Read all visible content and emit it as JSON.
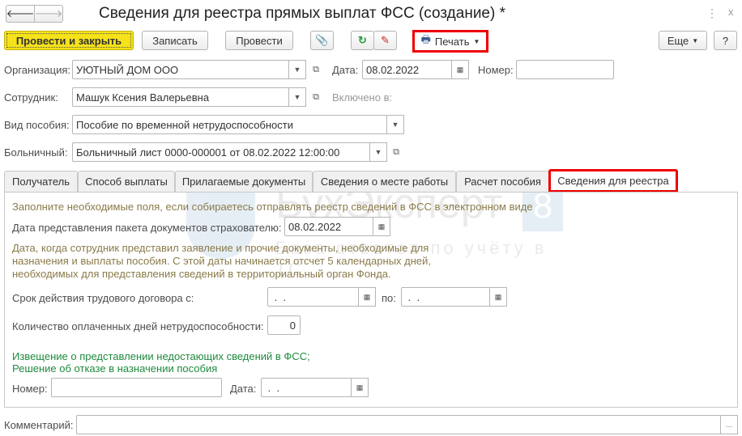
{
  "title": "Сведения для реестра прямых выплат ФСС (создание) *",
  "toolbar": {
    "post_close": "Провести и закрыть",
    "save": "Записать",
    "post": "Провести",
    "print": "Печать",
    "more": "Еще",
    "help": "?"
  },
  "header": {
    "org_label": "Организация:",
    "org_value": "УЮТНЫЙ ДОМ ООО",
    "date_label": "Дата:",
    "date_value": "08.02.2022",
    "number_label": "Номер:",
    "number_value": "",
    "employee_label": "Сотрудник:",
    "employee_value": "Машук Ксения Валерьевна",
    "included_label": "Включено в:",
    "benefit_label": "Вид пособия:",
    "benefit_value": "Пособие по временной нетрудоспособности",
    "sick_label": "Больничный:",
    "sick_value": "Больничный лист 0000-000001 от 08.02.2022 12:00:00"
  },
  "tabs": [
    "Получатель",
    "Способ выплаты",
    "Прилагаемые документы",
    "Сведения о месте работы",
    "Расчет пособия",
    "Сведения для реестра"
  ],
  "panel": {
    "hint": "Заполните необходимые поля, если собираетесь отправлять реестр сведений в ФСС в электронном виде",
    "submit_label": "Дата представления пакета документов страхователю:",
    "submit_value": "08.02.2022",
    "submit_note": [
      "Дата, когда сотрудник представил заявление и прочие документы, необходимые для",
      "назначения и выплаты пособия. С этой даты начинается отсчет 5 календарных дней,",
      "необходимых для представления сведений в территориальный орган Фонда."
    ],
    "contract_label": "Срок действия трудового договора с:",
    "contract_from": " .  .",
    "contract_to_label": "по:",
    "contract_to": " .  .",
    "days_label": "Количество оплаченных дней нетрудоспособности:",
    "days_value": "0",
    "notice_line1": "Извещение о представлении недостающих сведений в ФСС;",
    "notice_line2": "Решение об отказе в назначении пособия",
    "num_label": "Номер:",
    "num_value": "",
    "date_label": "Дата:",
    "date_value": " .  ."
  },
  "comment_label": "Комментарий:",
  "comment_value": "",
  "watermark": {
    "brand": "БухЭксперт 8",
    "tagline": "База ответов по учёту в 1С"
  }
}
